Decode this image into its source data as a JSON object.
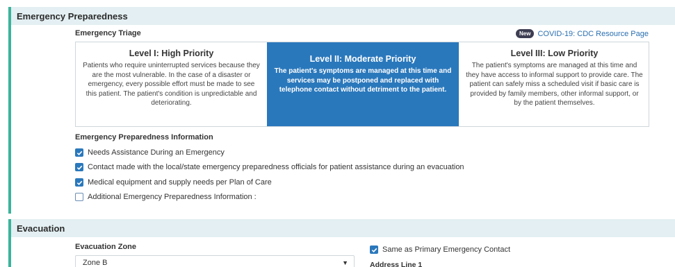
{
  "sections": {
    "emergency": {
      "title": "Emergency Preparedness",
      "triage_label": "Emergency Triage",
      "new_badge": "New",
      "cdc_link": "COVID-19: CDC Resource Page",
      "levels": [
        {
          "title": "Level I: High Priority",
          "description": "Patients who require uninterrupted services because they are the most vulnerable. In the case of a disaster or emergency, every possible effort must be made to see this patient. The patient's condition is unpredictable and deteriorating.",
          "selected": false
        },
        {
          "title": "Level II: Moderate Priority",
          "description": "The patient's symptoms are managed at this time and services may be postponed and replaced with telephone contact without detriment to the patient.",
          "selected": true
        },
        {
          "title": "Level III: Low Priority",
          "description": "The patient's symptoms are managed at this time and they have access to informal support to provide care. The patient can safely miss a scheduled visit if basic care is provided by family members, other informal support, or by the patient themselves.",
          "selected": false
        }
      ],
      "info_label": "Emergency Preparedness Information",
      "checkboxes": [
        {
          "label": "Needs Assistance During an Emergency",
          "checked": true
        },
        {
          "label": "Contact made with the local/state emergency preparedness officials for patient assistance during an evacuation",
          "checked": true
        },
        {
          "label": "Medical equipment and supply needs per Plan of Care",
          "checked": true
        },
        {
          "label": "Additional Emergency Preparedness Information :",
          "checked": false
        }
      ]
    },
    "evacuation": {
      "title": "Evacuation",
      "zone_label": "Evacuation Zone",
      "zone_value": "Zone B",
      "same_as_label": "Same as Primary Emergency Contact",
      "same_as_checked": true,
      "address_label": "Address Line 1"
    }
  },
  "colors": {
    "accent_bar": "#3bb39b",
    "header_bg": "#e3eff2",
    "selected_bg": "#2a78bc",
    "link": "#2a6fb0"
  },
  "icons": {
    "checkbox_checked": "check-icon",
    "select_arrow": "caret-down-icon"
  }
}
